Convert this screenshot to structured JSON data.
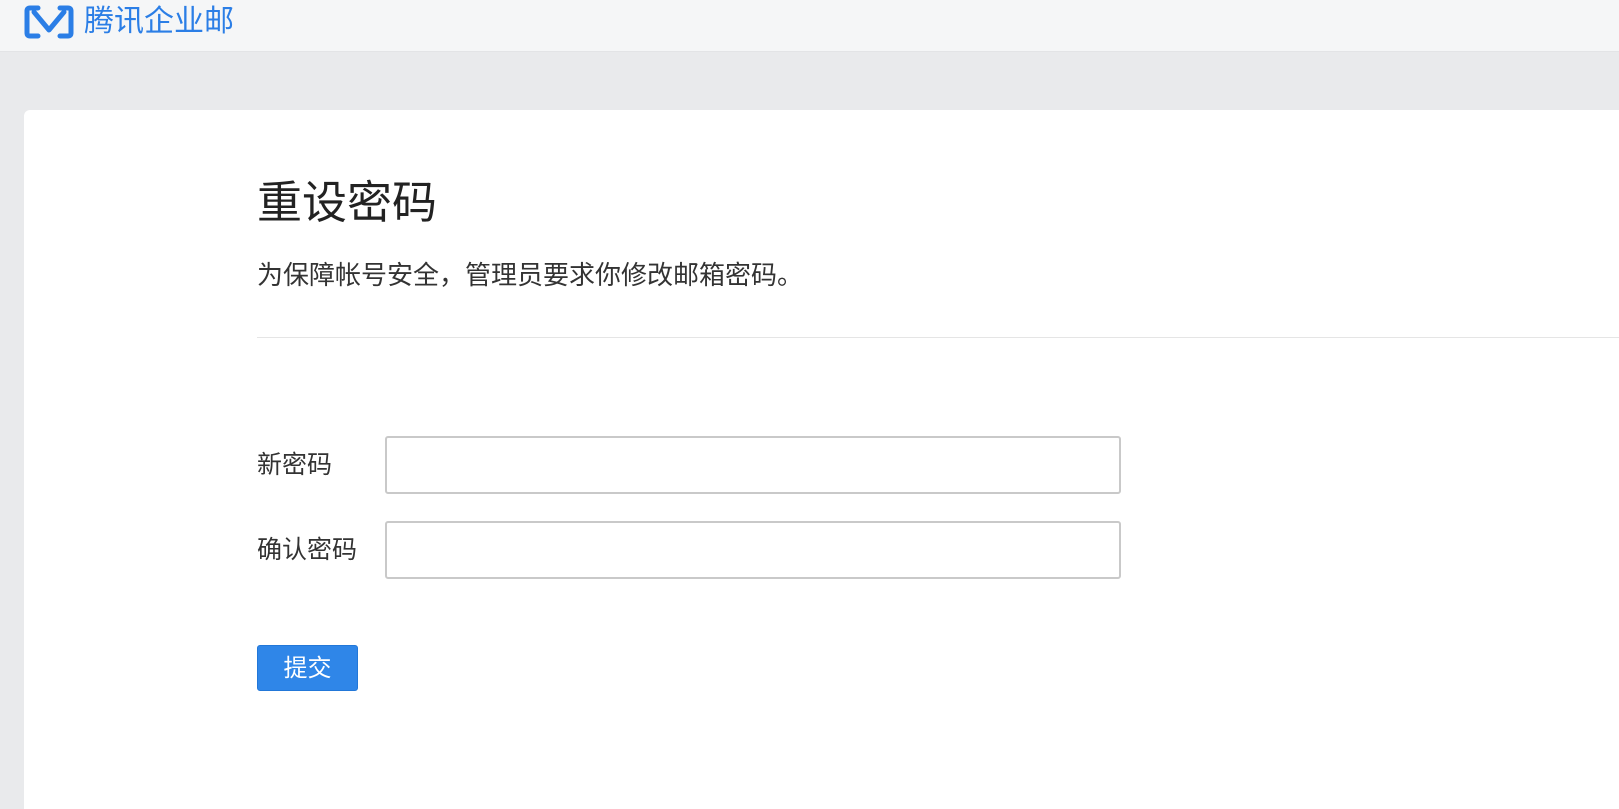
{
  "header": {
    "logo_icon": "tencent-exmail-logo-icon",
    "brand_text": "腾讯企业邮",
    "brand_color": "#2b7ee6"
  },
  "main": {
    "title": "重设密码",
    "notice": "为保障帐号安全，管理员要求你修改邮箱密码。",
    "form": {
      "new_password_label": "新密码",
      "new_password_value": "",
      "confirm_password_label": "确认密码",
      "confirm_password_value": ""
    },
    "submit_label": "提交",
    "accent_color": "#2f86e8"
  }
}
